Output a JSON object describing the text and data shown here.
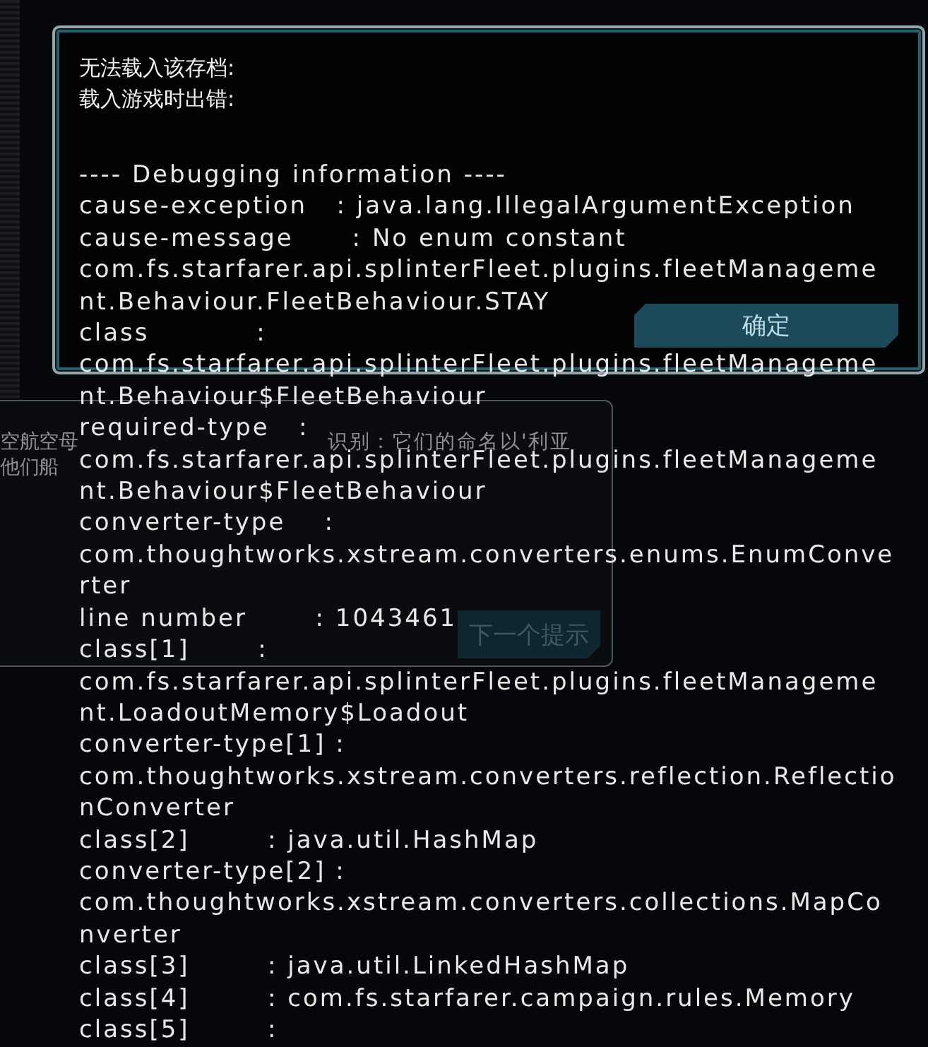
{
  "background_tip": {
    "text_lines": [
      {
        "segments": [
          "空航空母",
          "识别：它们的命名以'利亚"
        ]
      },
      {
        "segments": [
          "他们船"
        ]
      }
    ],
    "button": {
      "label": "下一个提示"
    }
  },
  "dialog": {
    "message_lines": [
      "无法载入该存档:",
      "载入游戏时出错:"
    ],
    "debug_lines": [
      "---- Debugging information ----",
      "cause-exception   : java.lang.IllegalArgumentException",
      "cause-message      : No enum constant",
      "com.fs.starfarer.api.splinterFleet.plugins.fleetManageme",
      "nt.Behaviour.FleetBehaviour.STAY",
      "class           :",
      "com.fs.starfarer.api.splinterFleet.plugins.fleetManageme",
      "nt.Behaviour$FleetBehaviour",
      "required-type   :",
      "com.fs.starfarer.api.splinterFleet.plugins.fleetManageme",
      "nt.Behaviour$FleetBehaviour",
      "converter-type    :",
      "com.thoughtworks.xstream.converters.enums.EnumConve",
      "rter",
      "line number       : 1043461",
      "class[1]       :",
      "com.fs.starfarer.api.splinterFleet.plugins.fleetManageme",
      "nt.LoadoutMemory$Loadout",
      "converter-type[1] :",
      "com.thoughtworks.xstream.converters.reflection.Reflectio",
      "nConverter",
      "class[2]        : java.util.HashMap",
      "converter-type[2] :",
      "com.thoughtworks.xstream.converters.collections.MapCo",
      "nverter",
      "class[3]        : java.util.LinkedHashMap",
      "class[4]        : com.fs.starfarer.campaign.rules.Memory",
      "class[5]        :"
    ],
    "buttons": [
      "确定"
    ]
  }
}
